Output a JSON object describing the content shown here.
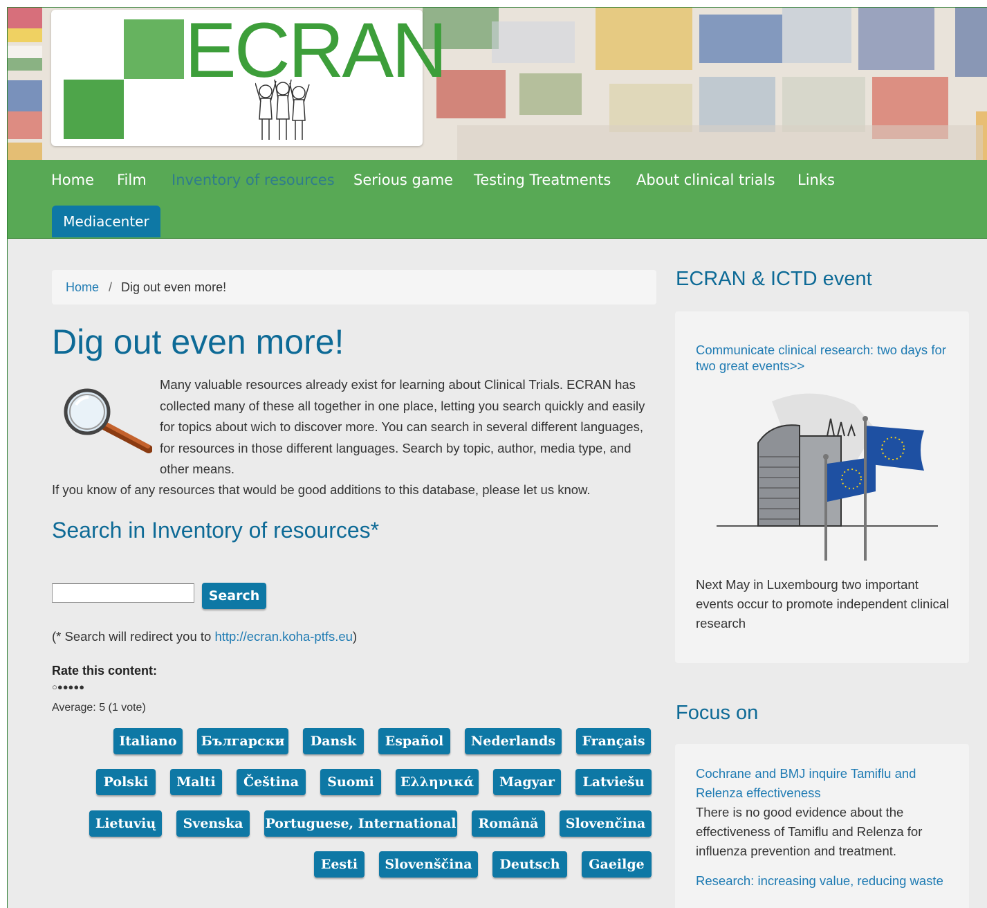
{
  "logo": {
    "text": "ECRAN"
  },
  "nav": {
    "items": [
      "Home",
      "Film",
      "Inventory of resources",
      "Serious game",
      "Testing Treatments",
      "About clinical trials",
      "Links"
    ],
    "mediacenter": "Mediacenter"
  },
  "breadcrumb": {
    "home": "Home",
    "separator": "/",
    "current": "Dig out even more!"
  },
  "page": {
    "title": "Dig out even more!",
    "intro": "Many valuable resources already exist for learning about Clinical Trials. ECRAN has collected many of these all together in one place, letting you search quickly and easily for topics about wich to discover more. You can search in several different languages, for resources in those different languages. Search by topic, author, media type, and other means.",
    "intro2": "If you know of any resources that would be good additions to this database, please let us know."
  },
  "search": {
    "heading": "Search in Inventory of resources*",
    "input_value": "",
    "button": "Search",
    "note_prefix": "(* Search will redirect you to ",
    "note_link": "http://ecran.koha-ptfs.eu",
    "note_suffix": ")"
  },
  "rating": {
    "label": "Rate this content:",
    "stars": "○●●●●●",
    "average": "Average: 5 (1 vote)"
  },
  "languages": [
    "Italiano",
    "Български",
    "Dansk",
    "Español",
    "Nederlands",
    "Français",
    "Polski",
    "Malti",
    "Čeština",
    "Suomi",
    "Ελληνικά",
    "Magyar",
    "Latviešu",
    "Lietuvių",
    "Svenska",
    "Portuguese, International",
    "Română",
    "Slovenčina",
    "Eesti",
    "Slovenščina",
    "Deutsch",
    "Gaeilge"
  ],
  "sidebar": {
    "event_heading": "ECRAN & ICTD event",
    "event_link": "Communicate clinical research: two days for two great events>>",
    "event_text": "Next May in Luxembourg two important events occur to promote independent clinical research",
    "focus_heading": "Focus on",
    "focus_link1": "Cochrane and BMJ inquire Tamiflu and Relenza effectiveness",
    "focus_text": "There is no good evidence about the effectiveness of Tamiflu and Relenza for influenza prevention and treatment.",
    "focus_link2": "Research: increasing value, reducing waste"
  },
  "colors": {
    "nav_green": "#58a955",
    "button_blue": "#0e78a5",
    "heading_blue": "#0d6a96",
    "link_blue": "#1f7bb3",
    "logo_green": "#3d9e3a"
  }
}
